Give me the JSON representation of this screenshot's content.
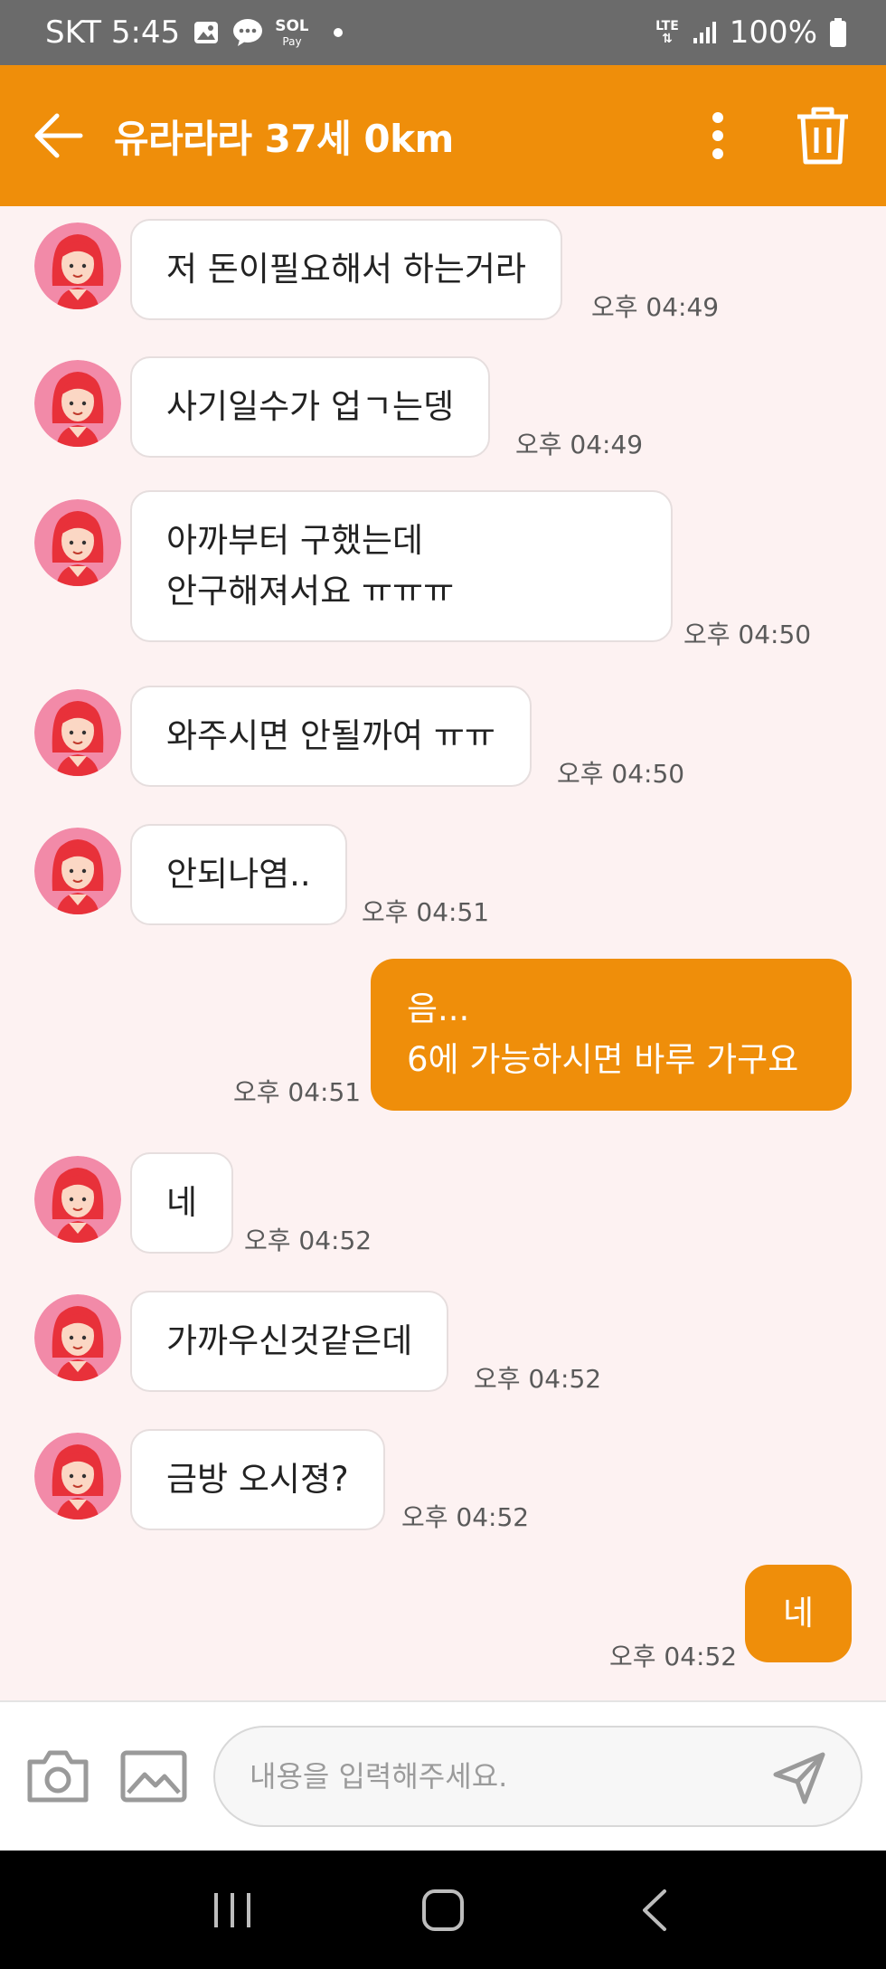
{
  "status_bar": {
    "carrier_time": "SKT 5:45",
    "pay_label": "Pay",
    "network": "LTE",
    "battery": "100%"
  },
  "header": {
    "title": "유라라라 37세 0km"
  },
  "colors": {
    "accent": "#ef8e0a",
    "chat_bg": "#fdf2f2",
    "incoming_bubble": "#ffffff"
  },
  "messages": [
    {
      "side": "in",
      "text": "저 돈이필요해서 하는거라",
      "time": "오후 04:49"
    },
    {
      "side": "in",
      "text": "사기일수가 업ㄱ는뎅",
      "time": "오후 04:49"
    },
    {
      "side": "in",
      "lines": [
        "아까부터 구했는데",
        "안구해져서요 ㅠㅠㅠ"
      ],
      "time": "오후 04:50"
    },
    {
      "side": "in",
      "text": "와주시면 안될까여 ㅠㅠ",
      "time": "오후 04:50"
    },
    {
      "side": "in",
      "text": "안되나염..",
      "time": "오후 04:51"
    },
    {
      "side": "out",
      "lines": [
        "음...",
        "6에 가능하시면 바루 가구요"
      ],
      "time": "오후 04:51"
    },
    {
      "side": "in",
      "text": "네",
      "time": "오후 04:52"
    },
    {
      "side": "in",
      "text": "가까우신것같은데",
      "time": "오후 04:52"
    },
    {
      "side": "in",
      "text": "금방 오시졍?",
      "time": "오후 04:52"
    },
    {
      "side": "out",
      "text": "네",
      "time": "오후 04:52"
    }
  ],
  "composer": {
    "placeholder": "내용을 입력해주세요."
  },
  "icons": {
    "back": "arrow-left-icon",
    "more": "more-vertical-icon",
    "delete": "trash-icon",
    "camera": "camera-icon",
    "gallery": "image-icon",
    "send": "send-icon"
  }
}
